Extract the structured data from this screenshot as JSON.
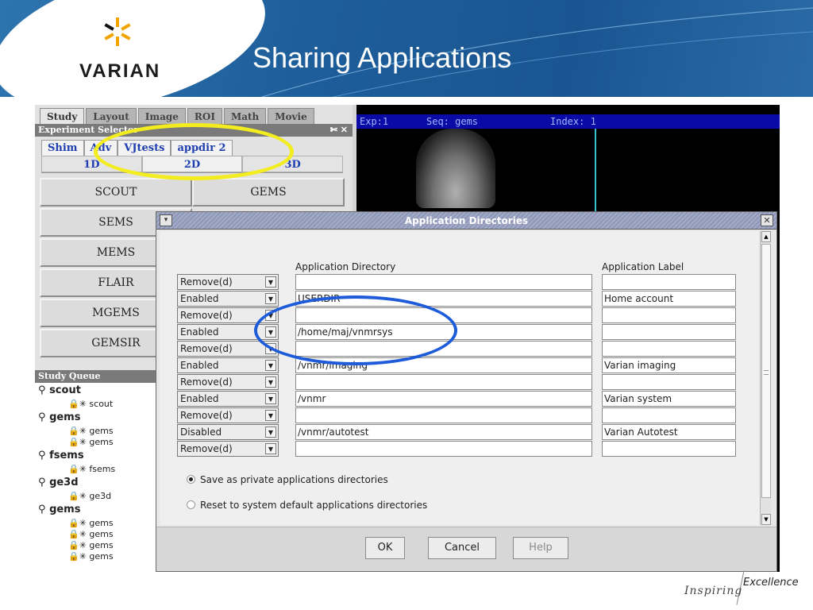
{
  "slide": {
    "title": "Sharing Applications",
    "logo_text": "VARIAN",
    "tagline_inspiring": "Inspiring",
    "tagline_excellence": "Excellence"
  },
  "colors": {
    "banner": "#1d5d99",
    "annotation_yellow": "#f3ec1e",
    "annotation_blue": "#1d5bd9",
    "dialog_title": "#9aa1c0"
  },
  "left_panel": {
    "top_tabs": [
      "Study",
      "Layout",
      "Image",
      "ROI",
      "Math",
      "Movie"
    ],
    "experiment_selector_title": "Experiment Selector",
    "experiment_selector_controls": "✄ ✕",
    "app_tabs": [
      "Shim",
      "Adv",
      "VJtests",
      "appdir 2"
    ],
    "dim_tabs": [
      "1D",
      "2D",
      "3D"
    ],
    "sequences": [
      "SCOUT",
      "GEMS",
      "SEMS",
      "MEMS",
      "FLAIR",
      "MGEMS",
      "GEMSIR"
    ],
    "study_queue_title": "Study Queue",
    "study_queue": [
      {
        "label": "scout",
        "children": [
          "scout"
        ]
      },
      {
        "label": "gems",
        "children": [
          "gems",
          "gems"
        ]
      },
      {
        "label": "fsems",
        "children": [
          "fsems"
        ]
      },
      {
        "label": "ge3d",
        "children": [
          "ge3d"
        ]
      },
      {
        "label": "gems",
        "children": [
          "gems",
          "gems",
          "gems",
          "gems"
        ]
      }
    ]
  },
  "image_panel": {
    "exp": "Exp:1",
    "seq": "Seq: gems",
    "index": "Index: 1"
  },
  "dialog": {
    "title": "Application Directories",
    "header_directory": "Application Directory",
    "header_label": "Application Label",
    "rows": [
      {
        "status": "Remove(d)",
        "directory": "",
        "label": ""
      },
      {
        "status": "Enabled",
        "directory": "USERDIR",
        "label": "Home account"
      },
      {
        "status": "Remove(d)",
        "directory": "",
        "label": ""
      },
      {
        "status": "Enabled",
        "directory": "/home/maj/vnmrsys",
        "label": ""
      },
      {
        "status": "Remove(d)",
        "directory": "",
        "label": ""
      },
      {
        "status": "Enabled",
        "directory": "/vnmr/imaging",
        "label": "Varian imaging"
      },
      {
        "status": "Remove(d)",
        "directory": "",
        "label": ""
      },
      {
        "status": "Enabled",
        "directory": "/vnmr",
        "label": "Varian system"
      },
      {
        "status": "Remove(d)",
        "directory": "",
        "label": ""
      },
      {
        "status": "Disabled",
        "directory": "/vnmr/autotest",
        "label": "Varian Autotest"
      },
      {
        "status": "Remove(d)",
        "directory": "",
        "label": ""
      }
    ],
    "radio_private": "Save as private applications directories",
    "radio_reset": "Reset to system default applications directories",
    "radio_selected": "private",
    "ok": "OK",
    "cancel": "Cancel",
    "help": "Help"
  }
}
